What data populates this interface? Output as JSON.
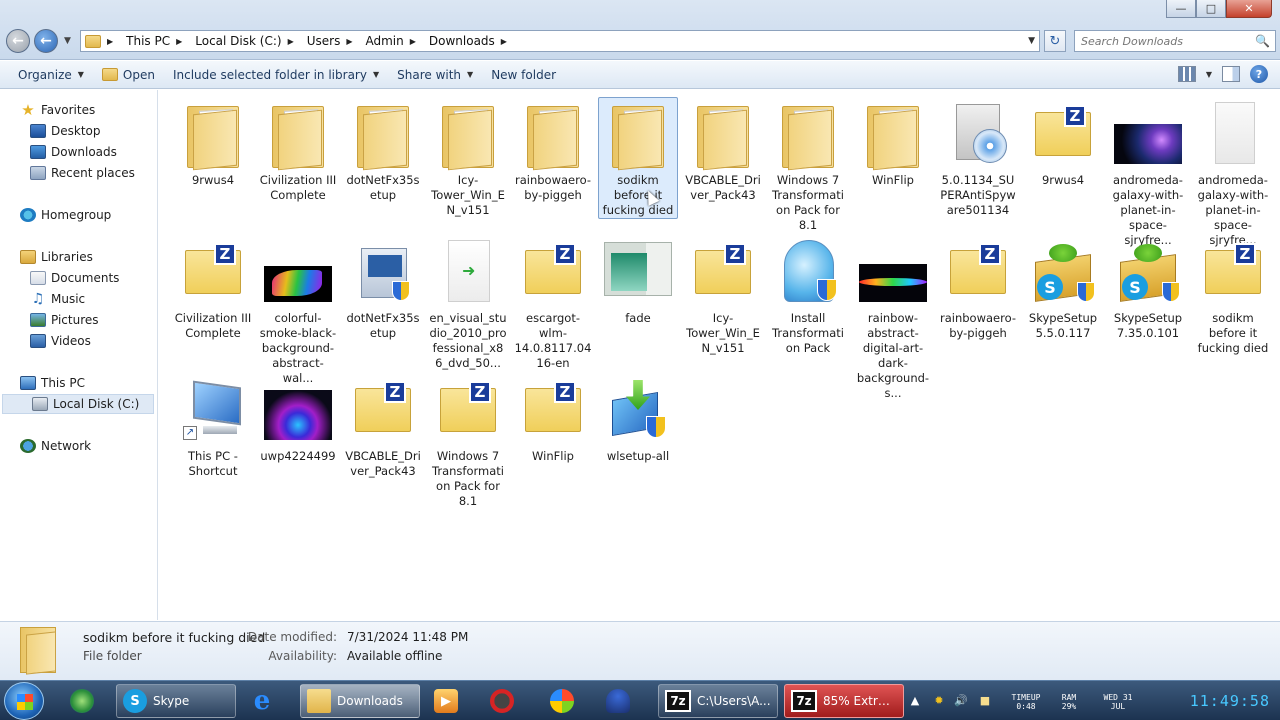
{
  "window": {
    "minimize_glyph": "—",
    "maximize_glyph": "□",
    "close_glyph": "✕"
  },
  "address": {
    "crumbs": [
      "This PC",
      "Local Disk (C:)",
      "Users",
      "Admin",
      "Downloads"
    ]
  },
  "search": {
    "placeholder": "Search Downloads"
  },
  "toolbar": {
    "organize": "Organize",
    "open": "Open",
    "include": "Include selected folder in library",
    "share": "Share with",
    "new_folder": "New folder"
  },
  "nav": {
    "favorites": "Favorites",
    "desktop": "Desktop",
    "downloads": "Downloads",
    "recent": "Recent places",
    "homegroup": "Homegroup",
    "libraries": "Libraries",
    "documents": "Documents",
    "music": "Music",
    "pictures": "Pictures",
    "videos": "Videos",
    "thispc": "This PC",
    "localdisk": "Local Disk (C:)",
    "network": "Network"
  },
  "files": {
    "r1": [
      {
        "name": "9rwus4",
        "type": "folder"
      },
      {
        "name": "Civilization III Complete",
        "type": "folder"
      },
      {
        "name": "dotNetFx35setup",
        "type": "folder"
      },
      {
        "name": "Icy-Tower_Win_EN_v151",
        "type": "folder"
      },
      {
        "name": "rainbowaero-by-piggeh",
        "type": "folder"
      },
      {
        "name": "sodikm before it fucking died",
        "type": "folder-selected"
      },
      {
        "name": "VBCABLE_Driver_Pack43",
        "type": "folder"
      },
      {
        "name": "Windows 7 Transformation Pack for 8.1",
        "type": "folder"
      },
      {
        "name": "WinFlip",
        "type": "folder"
      },
      {
        "name": "5.0.1134_SUPERAntiSpyware501134",
        "type": "cd"
      },
      {
        "name": "9rwus4",
        "type": "zip"
      },
      {
        "name": "andromeda-galaxy-with-planet-in-space-sjryfre...",
        "type": "galaxy"
      },
      {
        "name": "andromeda-galaxy-with-planet-in-space-sjryfre...",
        "type": "blank"
      }
    ],
    "r2": [
      {
        "name": "Civilization III Complete",
        "type": "zip"
      },
      {
        "name": "colorful-smoke-black-background-abstract-wal...",
        "type": "smoke"
      },
      {
        "name": "dotNetFx35setup",
        "type": "setup"
      },
      {
        "name": "en_visual_studio_2010_professional_x86_dvd_50...",
        "type": "vs"
      },
      {
        "name": "escargot-wlm-14.0.8117.0416-en",
        "type": "zip"
      },
      {
        "name": "fade",
        "type": "fade"
      },
      {
        "name": "Icy-Tower_Win_EN_v151",
        "type": "zip"
      },
      {
        "name": "Install Transformation Pack",
        "type": "installer"
      },
      {
        "name": "rainbow-abstract-digital-art-dark-background-s...",
        "type": "wave"
      },
      {
        "name": "rainbowaero-by-piggeh",
        "type": "zip"
      },
      {
        "name": "SkypeSetup 5.5.0.117",
        "type": "skype"
      },
      {
        "name": "SkypeSetup 7.35.0.101",
        "type": "skype"
      },
      {
        "name": "sodikm before it fucking died",
        "type": "zip"
      }
    ],
    "r3": [
      {
        "name": "This PC - Shortcut",
        "type": "pc"
      },
      {
        "name": "uwp4224499",
        "type": "uwp"
      },
      {
        "name": "VBCABLE_Driver_Pack43",
        "type": "zip"
      },
      {
        "name": "Windows 7 Transformation Pack for 8.1",
        "type": "zip"
      },
      {
        "name": "WinFlip",
        "type": "zip"
      },
      {
        "name": "wlsetup-all",
        "type": "wlsetup"
      }
    ]
  },
  "details": {
    "name": "sodikm before it fucking died",
    "type": "File folder",
    "modified_label": "Date modified:",
    "modified_value": "7/31/2024 11:48 PM",
    "availability_label": "Availability:",
    "availability_value": "Available offline"
  },
  "taskbar": {
    "skype": "Skype",
    "downloads": "Downloads",
    "sevenzip_path": "C:\\Users\\A...",
    "sevenzip_extract": "85% Extract...",
    "sevenzip_badge": "7z",
    "timeup_label": "TIMEUP",
    "timeup_value": "0:48",
    "ram_label": "RAM",
    "ram_value": "29%",
    "day": "WED 31",
    "month": "JUL",
    "clock": "11:49:58"
  }
}
